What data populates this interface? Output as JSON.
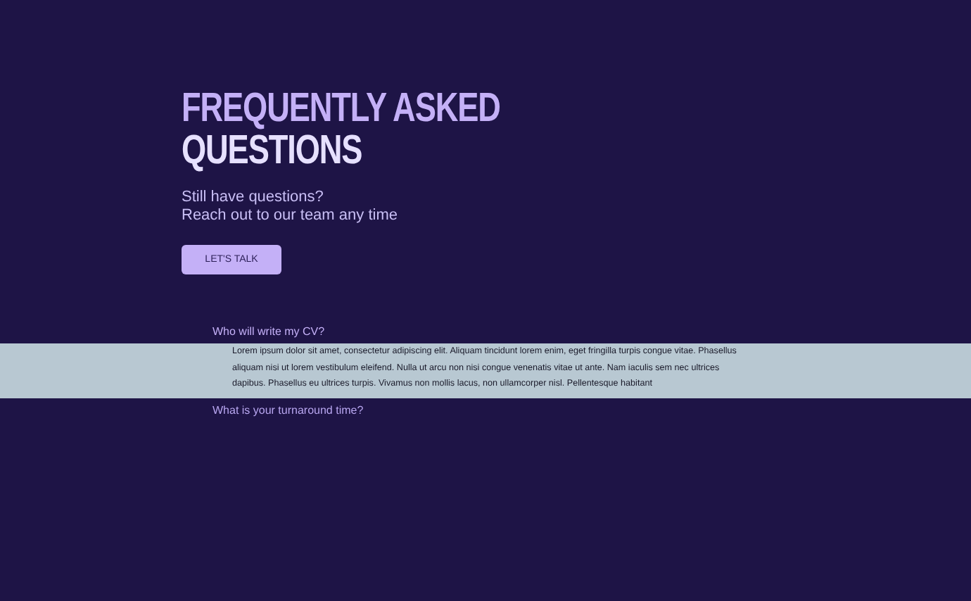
{
  "heading": {
    "line_1": "FREQUENTLY ASKED",
    "line_2": "QUESTIONS"
  },
  "subtitle": {
    "line_1": "Still have questions?",
    "line_2": "Reach out to our team any time"
  },
  "cta_button": "LET'S TALK",
  "faq": [
    {
      "question": "Who will write my CV?",
      "expanded": true,
      "answer": "Lorem ipsum dolor sit amet, consectetur adipiscing elit. Aliquam tincidunt lorem enim, eget fringilla turpis congue vitae. Phasellus aliquam nisi ut lorem vestibulum eleifend. Nulla ut arcu non nisi congue venenatis vitae ut ante. Nam iaculis sem nec ultrices dapibus. Phasellus eu ultrices turpis. Vivamus non mollis lacus, non ullamcorper nisl. Pellentesque habitant"
    },
    {
      "question": "What is your turnaround time?",
      "expanded": false
    }
  ]
}
